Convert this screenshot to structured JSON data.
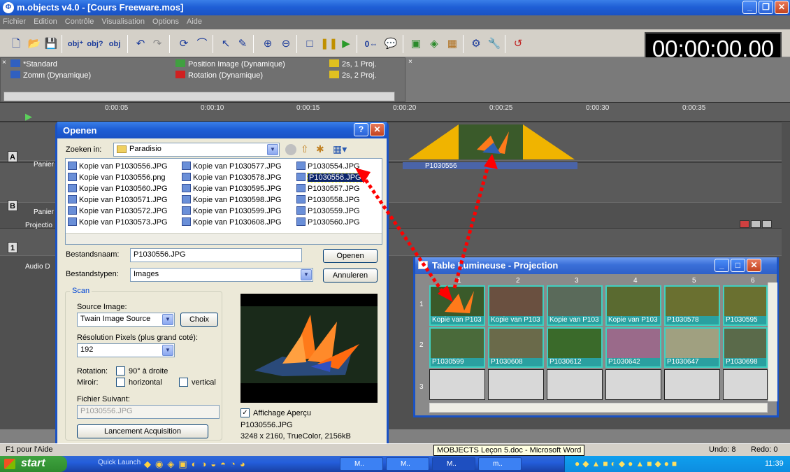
{
  "window": {
    "title": "m.objects v4.0 - [Cours Freeware.mos]"
  },
  "menu": [
    "Fichier",
    "Edition",
    "Contrôle",
    "Visualisation",
    "Options",
    "Aide"
  ],
  "timecode": "00:00:00.00",
  "effects": [
    {
      "label": "*Standard",
      "color": "#3060c0"
    },
    {
      "label": "Zomm (Dynamique)",
      "color": "#3060c0"
    },
    {
      "label": "Position Image (Dynamique)",
      "color": "#40a040"
    },
    {
      "label": "Rotation (Dynamique)",
      "color": "#d02020"
    },
    {
      "label": "2s, 1 Proj.",
      "color": "#e0c020"
    },
    {
      "label": "2s, 2 Proj.",
      "color": "#e0c020"
    }
  ],
  "ruler": [
    "0:00:05",
    "0:00:10",
    "0:00:15",
    "0:00:20",
    "0:00:25",
    "0:00:30",
    "0:00:35"
  ],
  "tracks": {
    "a_letter": "A",
    "b_letter": "B",
    "a_label": "Panier",
    "b_label": "Panier",
    "projection_label": "Projectio",
    "audio_letter": "1",
    "audio_label": "Audio D",
    "clip_label": "P1030556"
  },
  "dialog": {
    "title": "Openen",
    "look_in_label": "Zoeken in:",
    "look_in_value": "Paradisio",
    "files_col1": [
      "Kopie van P1030556.JPG",
      "Kopie van P1030556.png",
      "Kopie van P1030560.JPG",
      "Kopie van P1030571.JPG",
      "Kopie van P1030572.JPG",
      "Kopie van P1030573.JPG"
    ],
    "files_col2": [
      "Kopie van P1030577.JPG",
      "Kopie van P1030578.JPG",
      "Kopie van P1030595.JPG",
      "Kopie van P1030598.JPG",
      "Kopie van P1030599.JPG",
      "Kopie van P1030608.JPG"
    ],
    "files_col3": [
      "P1030554.JPG",
      "P1030556.JPG",
      "P1030557.JPG",
      "P1030558.JPG",
      "P1030559.JPG",
      "P1030560.JPG"
    ],
    "filename_label": "Bestandsnaam:",
    "filename_value": "P1030556.JPG",
    "filetype_label": "Bestandstypen:",
    "filetype_value": "Images",
    "open_btn": "Openen",
    "cancel_btn": "Annuleren",
    "scan": {
      "legend": "Scan",
      "source_label": "Source Image:",
      "source_value": "Twain Image Source",
      "choice_btn": "Choix",
      "resolution_label": "Résolution Pixels (plus grand coté):",
      "resolution_value": "192",
      "rotation_label": "Rotation:",
      "rotation_option": "90° à droite",
      "mirror_label": "Miroir:",
      "mirror_h": "horizontal",
      "mirror_v": "vertical",
      "next_file_label": "Fichier Suivant:",
      "next_file_value": "P1030556.JPG",
      "launch_btn": "Lancement Acquisition"
    },
    "preview_checkbox": "Affichage Aperçu",
    "preview_file": "P1030556.JPG",
    "preview_info": "3248 x 2160, TrueColor, 2156kB"
  },
  "lighttable": {
    "title": "Table Lumineuse - Projection",
    "cols": [
      "1",
      "2",
      "3",
      "4",
      "5",
      "6"
    ],
    "rows": [
      "1",
      "2",
      "3"
    ],
    "row1": [
      "Kopie van P103",
      "Kopie van P103",
      "Kopie van P103",
      "Kopie van P103",
      "P1030578",
      "P1030595"
    ],
    "row2": [
      "P1030599",
      "P1030608",
      "P1030612",
      "P1030642",
      "P1030647",
      "P1030698"
    ]
  },
  "status": {
    "help": "F1 pour l'Aide",
    "tooltip": "MOBJECTS Leçon 5.doc - Microsoft Word",
    "undo": "Undo: 8",
    "redo": "Redo: 0"
  },
  "taskbar": {
    "start": "start",
    "quicklaunch": "Quick Launch",
    "tasks": [
      "M..",
      "M..",
      "M..",
      "m.."
    ],
    "clock": "11:39"
  }
}
